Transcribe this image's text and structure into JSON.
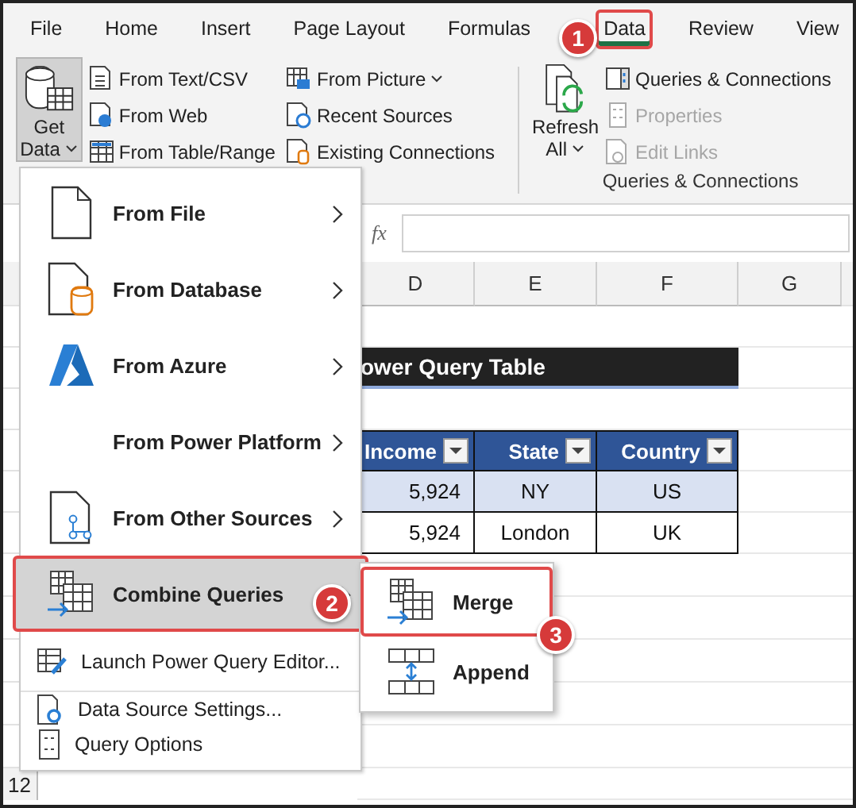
{
  "ribbon": {
    "tabs": [
      {
        "label": "File",
        "selected": false
      },
      {
        "label": "Home",
        "selected": false
      },
      {
        "label": "Insert",
        "selected": false
      },
      {
        "label": "Page Layout",
        "selected": false
      },
      {
        "label": "Formulas",
        "selected": false
      },
      {
        "label": "Data",
        "selected": true
      },
      {
        "label": "Review",
        "selected": false
      },
      {
        "label": "View",
        "selected": false
      }
    ],
    "get_data": {
      "label_top": "Get",
      "label_bottom": "Data",
      "pressed": true
    },
    "get_items": [
      {
        "label": "From Text/CSV",
        "kind": "text"
      },
      {
        "label": "From Web",
        "kind": "web"
      },
      {
        "label": "From Table/Range",
        "kind": "table"
      },
      {
        "label": "From Picture",
        "kind": "picture",
        "dropdown": true
      },
      {
        "label": "Recent Sources",
        "kind": "recent"
      },
      {
        "label": "Existing Connections",
        "kind": "existing"
      }
    ],
    "refresh": {
      "label_top": "Refresh",
      "label_bottom": "All"
    },
    "query_items": [
      {
        "label": "Queries & Connections",
        "kind": "panel",
        "disabled": false
      },
      {
        "label": "Properties",
        "kind": "properties",
        "disabled": true
      },
      {
        "label": "Edit Links",
        "kind": "links",
        "disabled": true
      }
    ],
    "group_label": "Queries & Connections"
  },
  "formula_bar": {
    "fx": "fx"
  },
  "sheet": {
    "columns": [
      "D",
      "E",
      "F",
      "G"
    ],
    "title": "ower Query Table",
    "headers": [
      "Income",
      "State",
      "Country"
    ],
    "rows": [
      [
        "5,924",
        "NY",
        "US"
      ],
      [
        "5,924",
        "London",
        "UK"
      ]
    ],
    "row_label": "12"
  },
  "menu": {
    "items": [
      {
        "label": "From File",
        "kind": "file",
        "submenu": true,
        "selected": false
      },
      {
        "label": "From Database",
        "kind": "database",
        "submenu": true,
        "selected": false
      },
      {
        "label": "From Azure",
        "kind": "azure",
        "submenu": true,
        "selected": false
      },
      {
        "label": "From Power Platform",
        "kind": "none",
        "submenu": true,
        "selected": false
      },
      {
        "label": "From Other Sources",
        "kind": "other",
        "submenu": true,
        "selected": false
      },
      {
        "label": "Combine Queries",
        "kind": "combine",
        "submenu": true,
        "selected": true
      },
      {
        "label": "Launch Power Query Editor...",
        "kind": "launch",
        "submenu": false,
        "selected": false
      },
      {
        "label": "Data Source Settings...",
        "kind": "settings",
        "submenu": false,
        "selected": false
      },
      {
        "label": "Query Options",
        "kind": "options",
        "submenu": false,
        "selected": false
      }
    ]
  },
  "submenu": {
    "items": [
      {
        "label": "Merge",
        "kind": "merge",
        "selected": true
      },
      {
        "label": "Append",
        "kind": "append",
        "selected": false
      }
    ]
  },
  "callouts": [
    "1",
    "2",
    "3"
  ]
}
